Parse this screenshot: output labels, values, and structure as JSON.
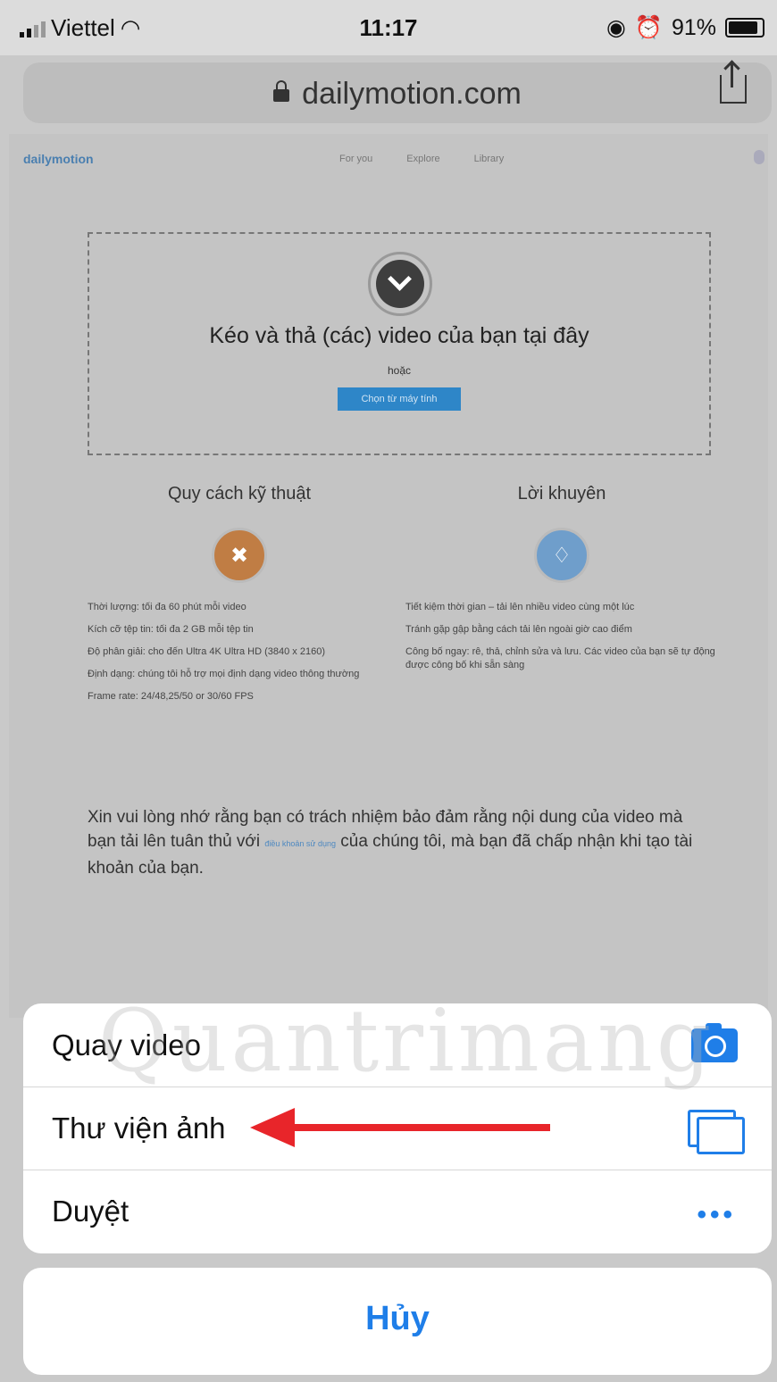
{
  "status_bar": {
    "carrier": "Viettel",
    "time": "11:17",
    "battery": "91%"
  },
  "browser": {
    "url": "dailymotion.com"
  },
  "site": {
    "logo": "dailymotion",
    "nav": [
      "For you",
      "Explore",
      "Library"
    ],
    "drop_zone": {
      "title": "Kéo và thả (các) video của bạn tại đây",
      "or": "hoặc",
      "button": "Chọn từ máy tính"
    },
    "specs": {
      "title": "Quy cách kỹ thuật",
      "items": [
        "Thời lượng: tối đa 60 phút mỗi video",
        "Kích cỡ tệp tin: tối đa 2 GB mỗi tệp tin",
        "Độ phân giải: cho đến Ultra 4K Ultra HD (3840 x 2160)",
        "Định dạng: chúng tôi hỗ trợ mọi định dạng video thông thường",
        "Frame rate: 24/48,25/50 or 30/60 FPS"
      ]
    },
    "tips": {
      "title": "Lời khuyên",
      "items": [
        "Tiết kiệm thời gian – tải lên nhiều video cùng một lúc",
        "Tránh gặp gập bằng cách tải lên ngoài giờ cao điểm",
        "Công bố ngay: rê, thả, chỉnh sửa và lưu. Các video của bạn sẽ tự động được công bố khi sẵn sàng"
      ]
    },
    "notice": {
      "before": "Xin vui lòng nhớ rằng bạn có trách nhiệm bảo đảm rằng nội dung của video mà bạn tải lên tuân thủ với ",
      "link": "điều khoản sử dụng",
      "after": " của chúng tôi, mà bạn đã chấp nhận khi tạo tài khoản của bạn."
    }
  },
  "action_sheet": {
    "items": [
      {
        "label": "Quay video",
        "icon": "camera-icon"
      },
      {
        "label": "Thư viện ảnh",
        "icon": "photos-icon"
      },
      {
        "label": "Duyệt",
        "icon": "more-icon"
      }
    ],
    "cancel": "Hủy"
  },
  "watermark": "Quantrimang",
  "colors": {
    "ios_blue": "#1f7ee8",
    "arrow_red": "#e8252a",
    "dm_button": "#2e86c8"
  }
}
